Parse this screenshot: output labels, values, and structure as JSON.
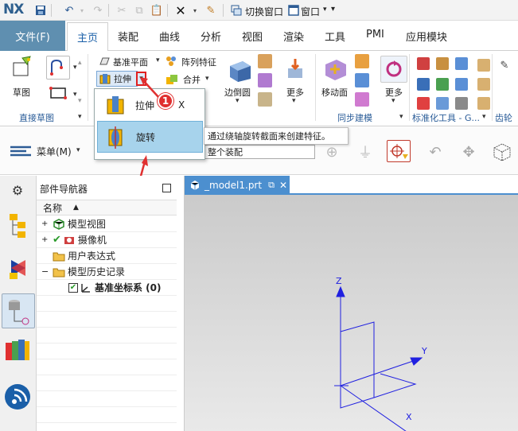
{
  "app": {
    "logo": "NX"
  },
  "quick_access": {
    "switch_window": "切换窗口",
    "window_menu": "窗口"
  },
  "menu": {
    "file": "文件(F)",
    "tabs": [
      "主页",
      "装配",
      "曲线",
      "分析",
      "视图",
      "渲染",
      "工具",
      "PMI",
      "应用模块"
    ],
    "active_tab": "主页"
  },
  "ribbon": {
    "sketch": "草图",
    "datum_plane": "基准平面",
    "pattern_feature": "阵列特征",
    "extrude": "拉伸",
    "unite": "合并",
    "edge_blend": "边倒圆",
    "more": "更多",
    "move_face": "移动面",
    "more2": "更多",
    "groups": {
      "direct_sketch": "直接草图",
      "sync_modeling": "同步建模",
      "std_tools": "标准化工具 - G...",
      "gear": "齿轮"
    }
  },
  "dropdown": {
    "extrude_label": "拉伸",
    "extrude_shortcut": "X",
    "revolve_label": "旋转"
  },
  "tooltip": {
    "text": "通过绕轴旋转截面来创建特征。"
  },
  "callouts": {
    "one": "1",
    "two": "2"
  },
  "toolbar2": {
    "menu_label": "菜单(M)",
    "assembly_select": "整个装配"
  },
  "navigator": {
    "title": "部件导航器",
    "column": "名称",
    "items": [
      {
        "label": "模型视图"
      },
      {
        "label": "摄像机"
      },
      {
        "label": "用户表达式"
      },
      {
        "label": "模型历史记录"
      },
      {
        "label": "基准坐标系 (0)"
      }
    ]
  },
  "viewport": {
    "tab_label": "_model1.prt",
    "axes": {
      "z": "Z",
      "y": "Y",
      "x": "X"
    }
  },
  "colors": {
    "accent": "#5f8fb0",
    "tab_blue": "#4c8fcf",
    "callout": "#e03030",
    "axis": "#2020e0"
  }
}
